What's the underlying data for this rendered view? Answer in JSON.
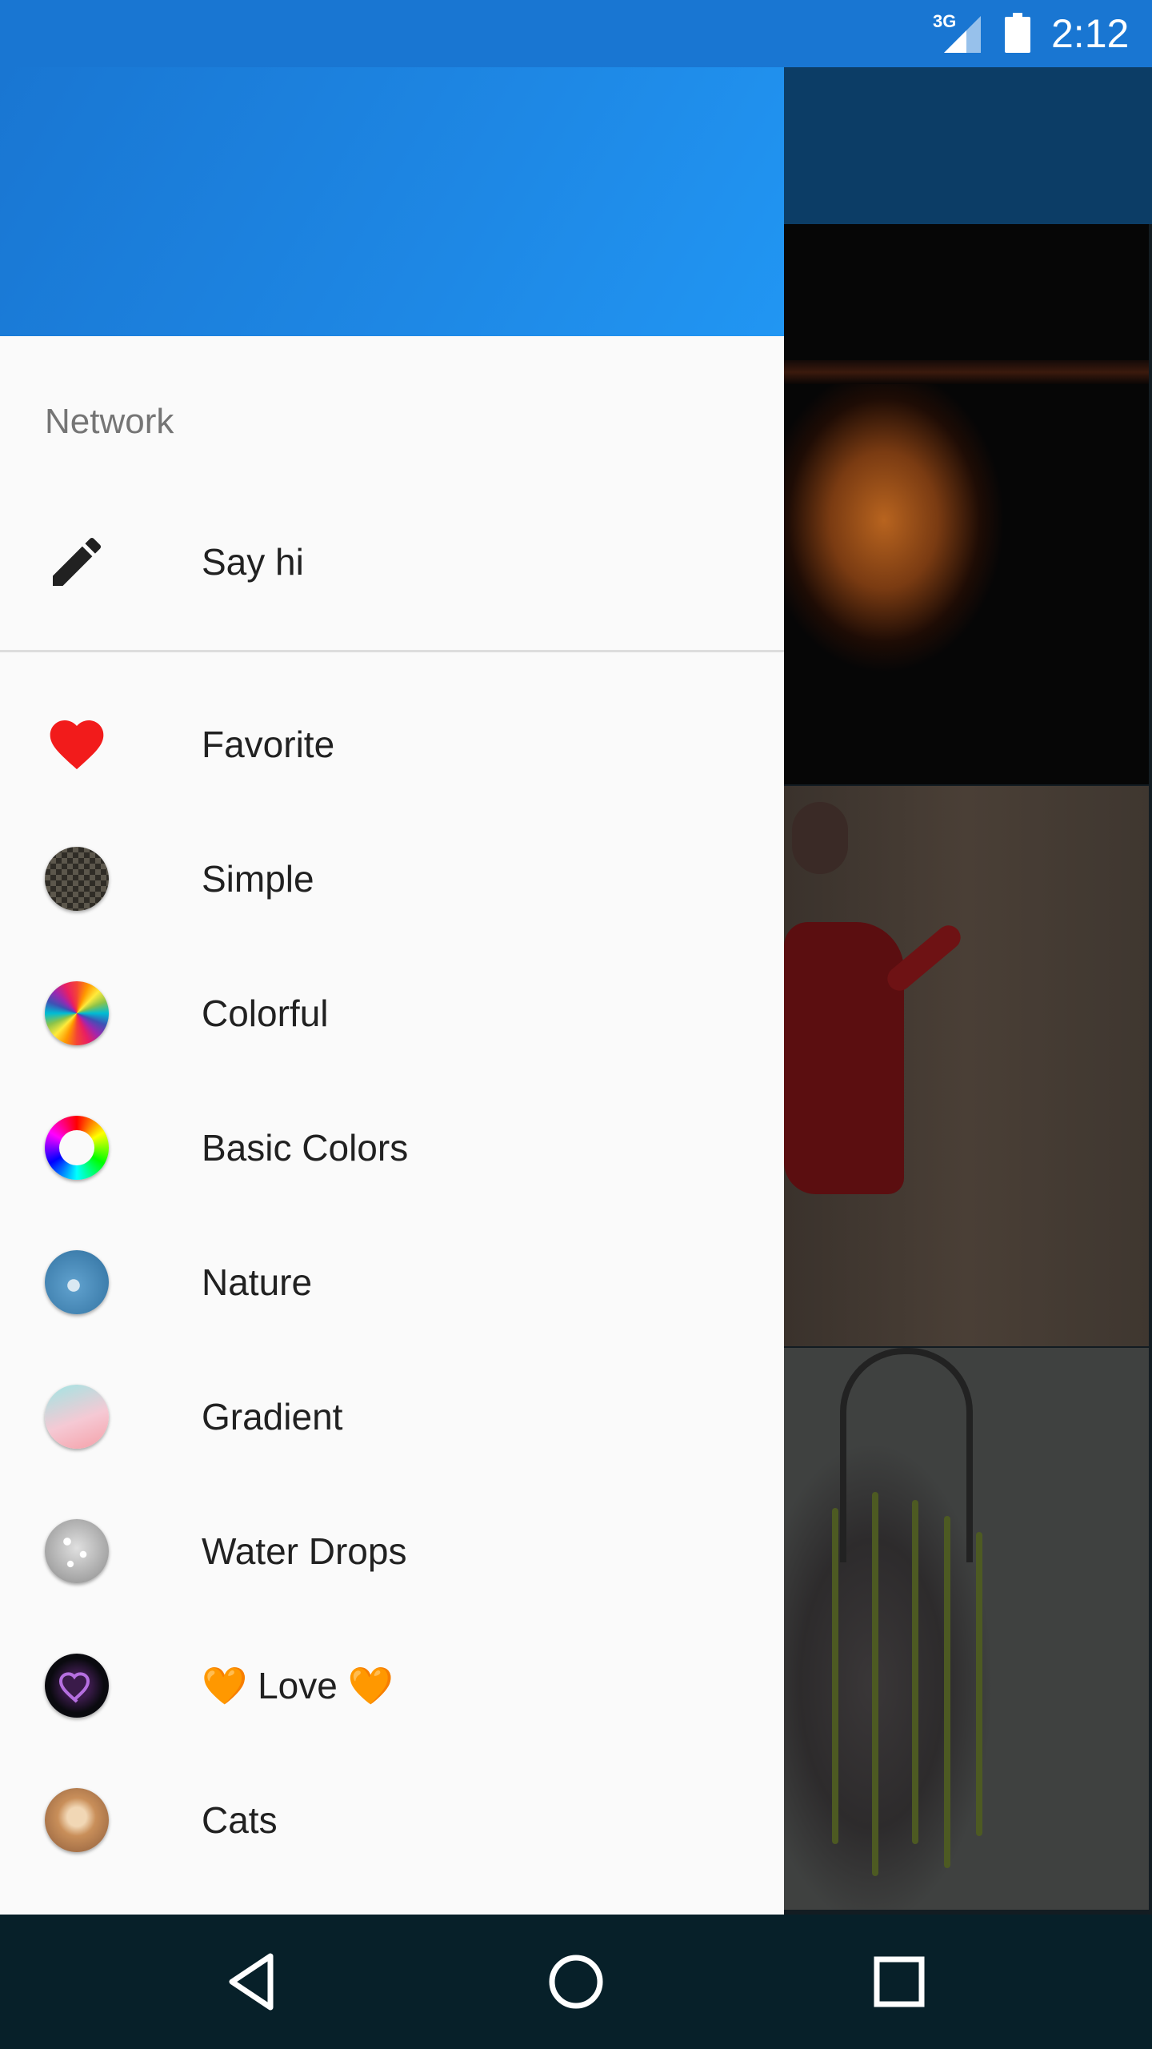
{
  "status_bar": {
    "network": "3G",
    "time": "2:12"
  },
  "drawer": {
    "section_title": "Network",
    "say_hi": {
      "label": "Say hi",
      "icon": "pencil-icon"
    },
    "categories": [
      {
        "label": "Favorite",
        "icon": "heart-icon"
      },
      {
        "label": "Simple",
        "icon": "checker-pattern-icon"
      },
      {
        "label": "Colorful",
        "icon": "colorful-wheel-icon"
      },
      {
        "label": "Basic Colors",
        "icon": "color-ring-icon"
      },
      {
        "label": "Nature",
        "icon": "dandelion-icon"
      },
      {
        "label": "Gradient",
        "icon": "gradient-icon"
      },
      {
        "label": "Water Drops",
        "icon": "water-drops-icon"
      },
      {
        "label": "Love",
        "icon": "love-heart-icon"
      },
      {
        "label": "Cats",
        "icon": "cat-icon"
      }
    ],
    "love_emoji": "🧡"
  },
  "colors": {
    "primary": "#1976d2",
    "drawer_header_end": "#2196f3",
    "favorite_heart": "#f21b1b",
    "nav_bar": "#072029"
  },
  "navigation": {
    "back": "back-icon",
    "home": "home-icon",
    "recents": "recents-icon"
  }
}
